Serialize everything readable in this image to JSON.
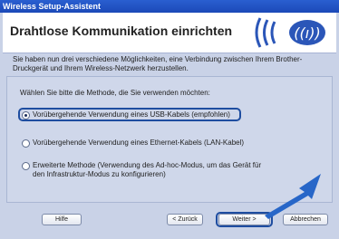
{
  "window": {
    "title": "Wireless Setup-Assistent"
  },
  "header": {
    "title": "Drahtlose Kommunikation einrichten"
  },
  "intro": {
    "text": "Sie haben nun drei verschiedene Möglichkeiten, eine Verbindung zwischen Ihrem Brother-Druckgerät und Ihrem Wireless-Netzwerk herzustellen."
  },
  "panel": {
    "prompt": "Wählen Sie bitte die Methode, die Sie verwenden möchten:",
    "options": [
      {
        "label": "Vorübergehende Verwendung eines USB-Kabels (empfohlen)",
        "selected": true
      },
      {
        "label": "Vorübergehende Verwendung eines Ethernet-Kabels (LAN-Kabel)",
        "selected": false
      },
      {
        "label": "Erweiterte Methode (Verwendung des Ad-hoc-Modus, um das Gerät für den Infrastruktur-Modus zu konfigurieren)",
        "selected": false
      }
    ]
  },
  "footer": {
    "help_label": "Hilfe",
    "back_label": "< Zurück",
    "next_label": "Weiter >",
    "cancel_label": "Abbrechen"
  },
  "colors": {
    "titlebar": "#1b49b8",
    "highlight": "#1e4da0",
    "arrow": "#2766c8",
    "panel": "#cfd7ea"
  },
  "icons": {
    "logo": "wireless-signal-logo-icon",
    "arrow": "pointer-arrow-icon"
  }
}
